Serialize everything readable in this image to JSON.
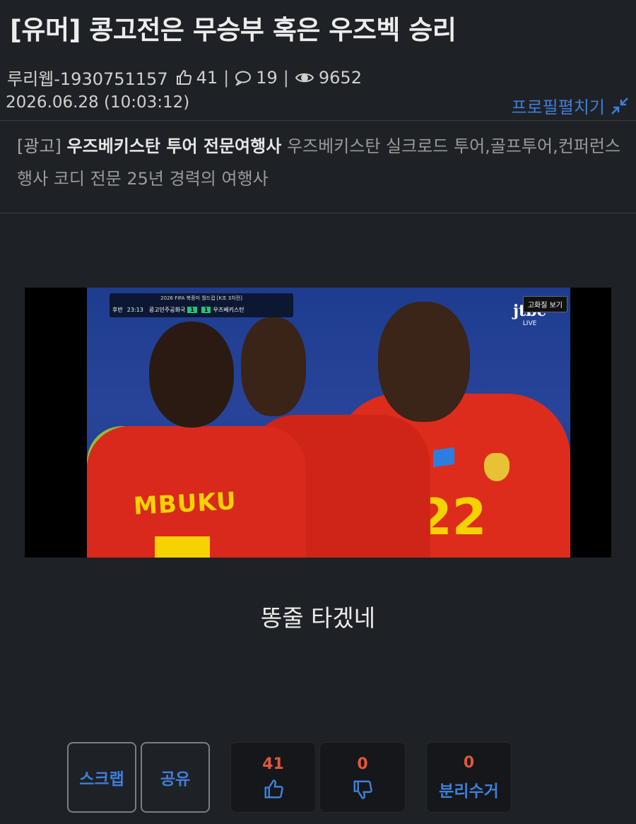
{
  "post": {
    "title": "[유머] 콩고전은 무승부 혹은 우즈벡 승리",
    "author": "루리웹-1930751157",
    "likes": "41",
    "comments": "19",
    "views": "9652",
    "date": "2026.06.28 (10:03:12)",
    "profile_toggle": "프로필펼치기"
  },
  "ad": {
    "tag": "[광고]",
    "headline": "우즈베키스탄 투어 전문여행사",
    "body": " 우즈베키스탄 실크로드 투어,골프투어,컨퍼런스 행사 코디 전문 25년 경력의 여행사"
  },
  "video": {
    "competition": "2026 FIFA 북중미 월드컵 [K조 3차전]",
    "half": "후반",
    "clock": "23:13",
    "home_team": "콩고민주공화국",
    "home_score": "1",
    "away_score": "1",
    "away_team": "우즈베키스탄",
    "broadcaster": "jtbc",
    "live": "LIVE",
    "hd_button": "고화질 보기",
    "player_name": "MBUKU",
    "player_number": "22"
  },
  "caption": "똥줄 타겠네",
  "actions": {
    "scrap": "스크랩",
    "share": "공유",
    "upvote_count": "41",
    "downvote_count": "0",
    "recycle_count": "0",
    "recycle_label": "분리수거"
  },
  "colors": {
    "background": "#1e2126",
    "link_blue": "#3f7fd6",
    "count_orange": "#e0583a"
  }
}
